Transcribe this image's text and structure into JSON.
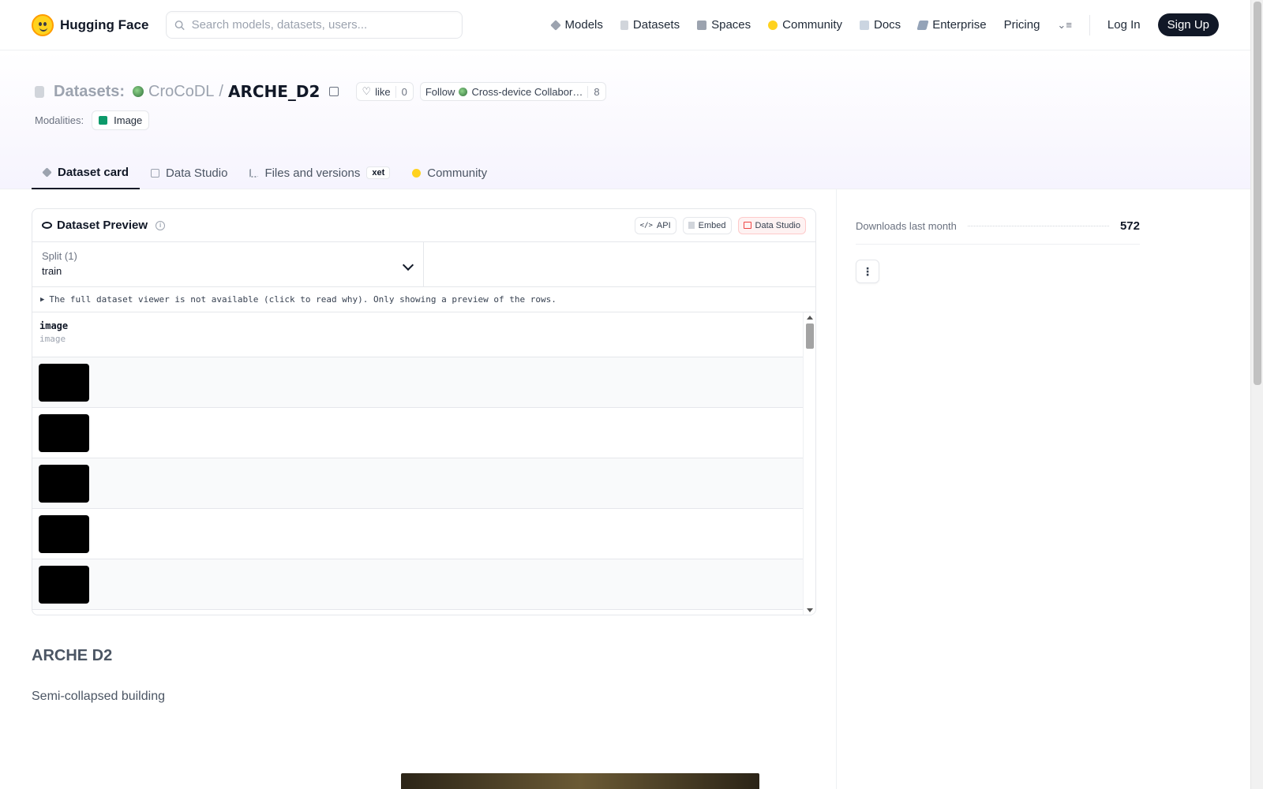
{
  "nav": {
    "brand": "Hugging Face",
    "search_placeholder": "Search models, datasets, users...",
    "links": [
      "Models",
      "Datasets",
      "Spaces",
      "Community",
      "Docs",
      "Enterprise",
      "Pricing"
    ],
    "login": "Log In",
    "signup": "Sign Up"
  },
  "header": {
    "section": "Datasets:",
    "org": "CroCoDL",
    "slash": "/",
    "repo": "ARCHE_D2",
    "like_label": "like",
    "like_count": "0",
    "follow_label": "Follow",
    "follow_org": "Cross-device Collabor…",
    "follow_count": "8",
    "modalities_label": "Modalities:",
    "modality": "Image"
  },
  "tabs": [
    {
      "label": "Dataset card",
      "active": true
    },
    {
      "label": "Data Studio"
    },
    {
      "label": "Files and versions",
      "badge": "xet"
    },
    {
      "label": "Community"
    }
  ],
  "preview": {
    "title": "Dataset Preview",
    "actions": [
      "API",
      "Embed",
      "Data Studio"
    ],
    "split_label": "Split (1)",
    "split_value": "train",
    "notice": "The full dataset viewer is not available (click to read why). Only showing a preview of the rows.",
    "column_name": "image",
    "column_type": "image"
  },
  "card": {
    "title": "ARCHE D2",
    "description": "Semi-collapsed building"
  },
  "sidebar": {
    "downloads_label": "Downloads last month",
    "downloads_value": "572",
    "more_icon": "⋮"
  },
  "colors": {
    "accent_dark": "#111827",
    "brand_yellow": "#ffd21e",
    "header_tint": "#f6f4fe"
  }
}
